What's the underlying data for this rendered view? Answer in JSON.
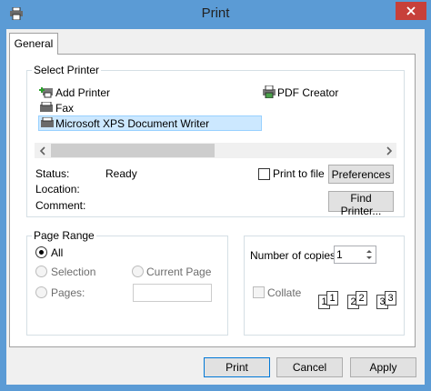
{
  "window": {
    "title": "Print"
  },
  "tabs": [
    {
      "label": "General"
    }
  ],
  "select_printer": {
    "group_label": "Select Printer",
    "printers": [
      {
        "label": "Add Printer",
        "icon": "add-printer-icon"
      },
      {
        "label": "PDF Creator",
        "icon": "pdf-printer-icon"
      },
      {
        "label": "Fax",
        "icon": "fax-printer-icon"
      },
      {
        "label": "Microsoft XPS Document Writer",
        "icon": "printer-icon",
        "selected": true
      }
    ],
    "status_label": "Status:",
    "status_value": "Ready",
    "location_label": "Location:",
    "location_value": "",
    "comment_label": "Comment:",
    "comment_value": "",
    "print_to_file_label": "Print to file",
    "print_to_file_checked": false,
    "preferences_label": "Preferences",
    "find_printer_label": "Find Printer..."
  },
  "page_range": {
    "group_label": "Page Range",
    "all_label": "All",
    "all_selected": true,
    "selection_label": "Selection",
    "current_page_label": "Current Page",
    "pages_label": "Pages:",
    "pages_value": ""
  },
  "copies": {
    "label": "Number of copies:",
    "value": "1",
    "collate_label": "Collate",
    "collate_checked": false,
    "collate_pages": [
      "1",
      "1",
      "2",
      "2",
      "3",
      "3"
    ]
  },
  "buttons": {
    "print": "Print",
    "cancel": "Cancel",
    "apply": "Apply"
  },
  "colors": {
    "frame": "#5b9bd5",
    "close": "#c7403a",
    "selection": "#cce8ff"
  }
}
